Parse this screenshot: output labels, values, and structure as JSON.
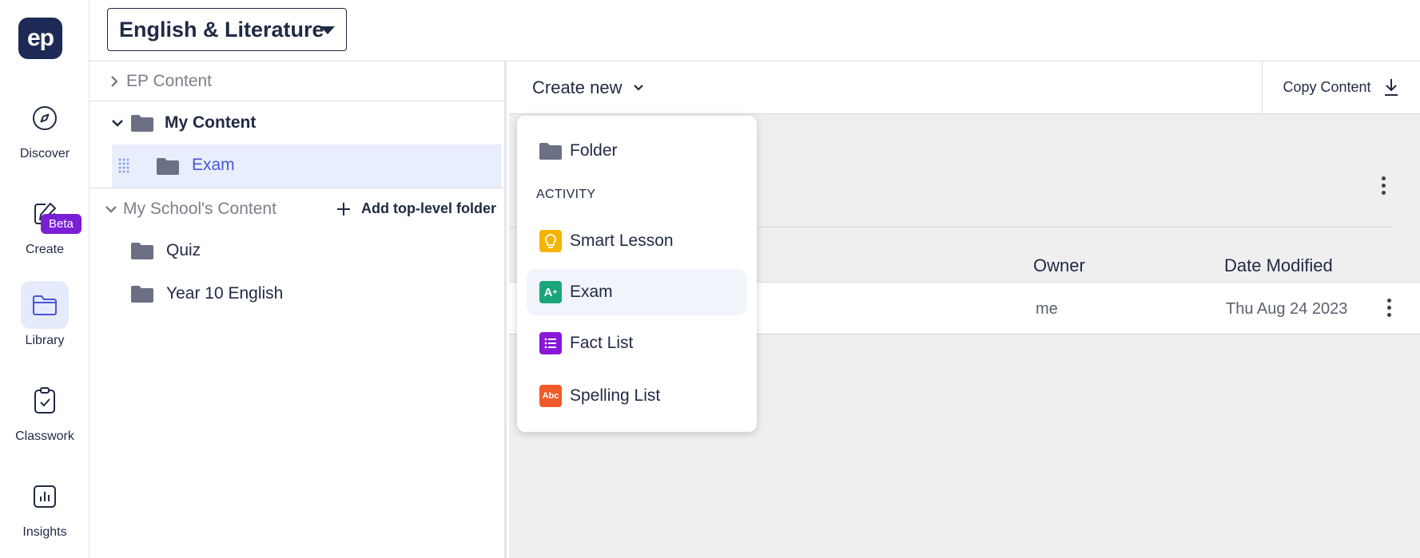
{
  "nav": {
    "logo_text": "ep",
    "beta_badge": "Beta",
    "items": [
      {
        "label": "Discover",
        "icon": "compass-icon"
      },
      {
        "label": "Create",
        "icon": "pencil-icon"
      },
      {
        "label": "Library",
        "icon": "folder-icon",
        "active": true
      },
      {
        "label": "Classwork",
        "icon": "clipboard-icon"
      },
      {
        "label": "Insights",
        "icon": "chart-icon"
      }
    ]
  },
  "topbar": {
    "subject": "English & Literature"
  },
  "tree": {
    "ep_content": "EP Content",
    "my_content": "My Content",
    "my_content_children": [
      "Exam"
    ],
    "school_content": "My School's Content",
    "add_folder": "Add top-level folder",
    "school_children": [
      "Quiz",
      "Year 10 English"
    ]
  },
  "toolbar": {
    "create_new": "Create new",
    "copy_content": "Copy Content"
  },
  "table": {
    "headers": {
      "owner": "Owner",
      "date": "Date Modified"
    },
    "rows": [
      {
        "owner": "me",
        "date": "Thu Aug 24 2023"
      }
    ]
  },
  "dropdown": {
    "folder": "Folder",
    "section": "ACTIVITY",
    "items": [
      {
        "label": "Smart Lesson",
        "color": "#f5b400"
      },
      {
        "label": "Exam",
        "color": "#1aa67a"
      },
      {
        "label": "Fact List",
        "color": "#8a17d8"
      },
      {
        "label": "Spelling List",
        "color": "#f05a2a",
        "icon_text": "Abc"
      }
    ]
  },
  "colors": {
    "brand": "#1d2a55",
    "accent": "#4a56d6",
    "beta": "#7b1fd6",
    "folder": "#6b7084"
  }
}
